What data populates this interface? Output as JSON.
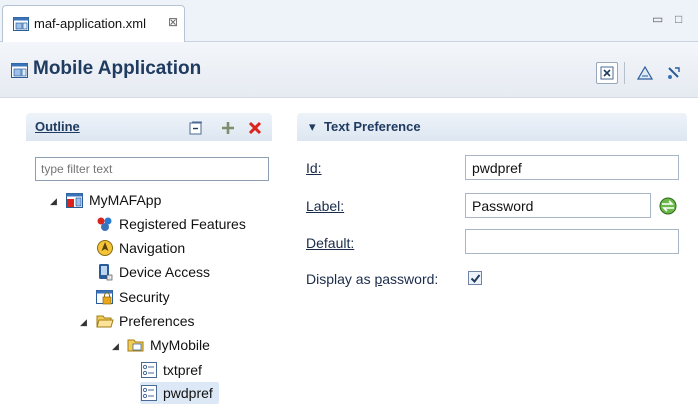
{
  "editor_tab": {
    "label": "maf-application.xml",
    "close_glyph": "⊠"
  },
  "window_controls": {
    "minimize": "▭",
    "maximize": "□"
  },
  "header": {
    "title": "Mobile Application"
  },
  "outline": {
    "title": "Outline",
    "filter_placeholder": "type filter text",
    "tree": [
      {
        "label": "MyMAFApp",
        "icon": "app-icon"
      },
      {
        "label": "Registered Features",
        "icon": "puzzle-icon"
      },
      {
        "label": "Navigation",
        "icon": "navigation-icon"
      },
      {
        "label": "Device Access",
        "icon": "device-icon"
      },
      {
        "label": "Security",
        "icon": "lock-icon"
      },
      {
        "label": "Preferences",
        "icon": "folder-open-icon"
      },
      {
        "label": "MyMobile",
        "icon": "folder-icon"
      },
      {
        "label": "txtpref",
        "icon": "preference-icon"
      },
      {
        "label": "pwdpref",
        "icon": "preference-icon"
      }
    ]
  },
  "details": {
    "title": "Text Preference",
    "fields": {
      "id": {
        "label": "Id:",
        "value": "pwdpref"
      },
      "label": {
        "label": "Label:",
        "value": "Password"
      },
      "default": {
        "label": "Default:",
        "value": ""
      },
      "display_password": {
        "label": "Display as password:",
        "checked": true
      }
    }
  },
  "colors": {
    "accent": "#1f3b60",
    "tab_bg": "#eef3fa",
    "selection": "#dde8f6",
    "delete": "#d9231b"
  }
}
